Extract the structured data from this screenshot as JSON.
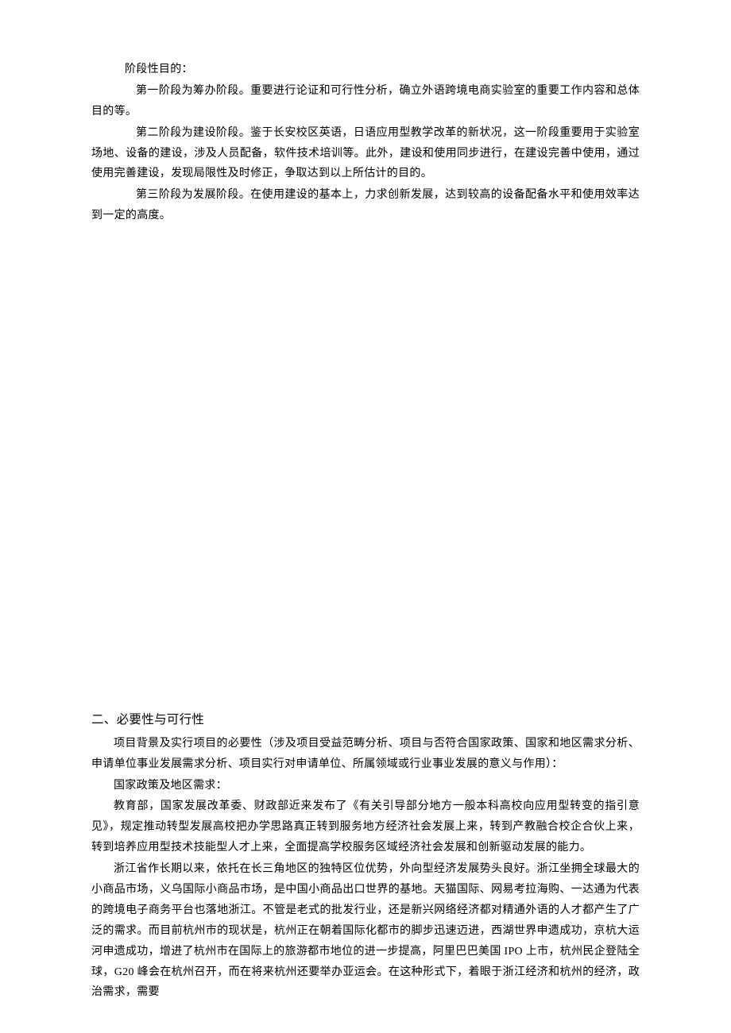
{
  "block1": {
    "label": "阶段性目的：",
    "p1": "第一阶段为筹办阶段。重要进行论证和可行性分析，确立外语跨境电商实验室的重要工作内容和总体目的等。",
    "p2": "第二阶段为建设阶段。鉴于长安校区英语，日语应用型教学改革的新状况，这一阶段重要用于实验室场地、设备的建设，涉及人员配备，软件技术培训等。此外，建设和使用同步进行，在建设完善中使用，通过使用完善建设，发现局限性及时修正，争取达到以上所估计的目的。",
    "p3": "第三阶段为发展阶段。在使用建设的基本上，力求创新发展，达到较高的设备配备水平和使用效率达到一定的高度。"
  },
  "block2": {
    "heading": "二、必要性与可行性",
    "intro": "项目背景及实行项目的必要性（涉及项目受益范畴分析、项目与否符合国家政策、国家和地区需求分析、申请单位事业发展需求分析、项目实行对申请单位、所属领域或行业事业发展的意义与作用）：",
    "label": "国家政策及地区需求：",
    "p1": "教育部，国家发展改革委、财政部近来发布了《有关引导部分地方一般本科高校向应用型转变的指引意见》，规定推动转型发展高校把办学思路真正转到服务地方经济社会发展上来，转到产教融合校企合伙上来，转到培养应用型技术技能型人才上来，全面提高学校服务区域经济社会发展和创新驱动发展的能力。",
    "p2": "浙江省作长期以来，依托在长三角地区的独特区位优势，外向型经济发展势头良好。浙江坐拥全球最大的小商品市场，义乌国际小商品市场，是中国小商品出口世界的基地。天猫国际、网易考拉海购、一达通为代表的跨境电子商务平台也落地浙江。不管是老式的批发行业，还是新兴网络经济都对精通外语的人才都产生了广泛的需求。而目前杭州市的现状是，杭州正在朝着国际化都市的脚步迅速迈进，西湖世界申遗成功，京杭大运河申遗成功，增进了杭州市在国际上的旅游都市地位的进一步提高，阿里巴巴美国 IPO 上市，杭州民企登陆全球，G20 峰会在杭州召开，而在将来杭州还要举办亚运会。在这种形式下，着眼于浙江经济和杭州的经济，政治需求，需要"
  }
}
